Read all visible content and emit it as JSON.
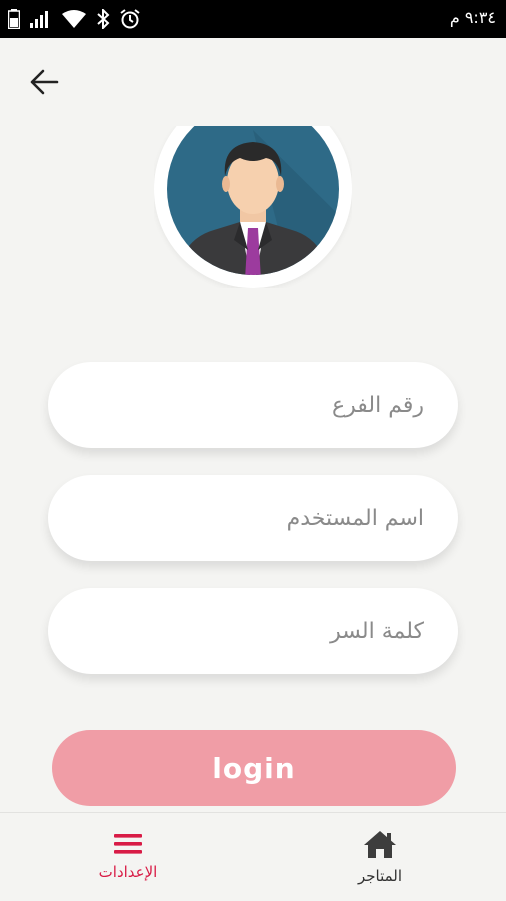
{
  "status_bar": {
    "time": "٩:٣٤ م",
    "icons": [
      "battery-icon",
      "signal-icon",
      "wifi-icon",
      "bluetooth-icon",
      "alarm-icon"
    ]
  },
  "header": {
    "back_icon": "arrow-left-icon"
  },
  "form": {
    "branch_number": {
      "placeholder": "رقم الفرع",
      "value": ""
    },
    "username": {
      "placeholder": "اسم المستخدم",
      "value": ""
    },
    "password": {
      "placeholder": "كلمة السر",
      "value": ""
    },
    "login_label": "login"
  },
  "bottom_nav": {
    "settings_label": "الإعدادات",
    "stores_label": "المتاجر"
  },
  "colors": {
    "accent": "#d81b46",
    "login_button": "#f09da6",
    "background": "#f4f4f2",
    "avatar_bg": "#2e6a87"
  }
}
